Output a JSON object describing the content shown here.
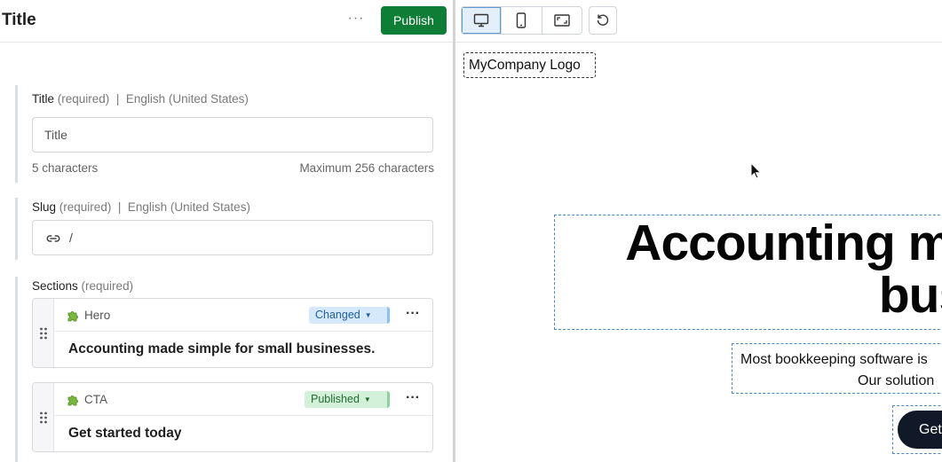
{
  "editor": {
    "title": "Title",
    "more_label": "···",
    "publish_label": "Publish",
    "fields": {
      "title": {
        "label": "Title",
        "required": "(required)",
        "separator": "|",
        "locale": "English (United States)",
        "value": "Title",
        "char_count": "5 characters",
        "max_chars": "Maximum 256 characters"
      },
      "slug": {
        "label": "Slug",
        "required": "(required)",
        "separator": "|",
        "locale": "English (United States)",
        "icon": "link-icon",
        "value": "/"
      },
      "sections": {
        "label": "Sections",
        "required": "(required)",
        "items": [
          {
            "type": "Hero",
            "icon": "puzzle-icon",
            "status": "Changed",
            "status_color": "#1f5f9e",
            "text": "Accounting made simple for small businesses."
          },
          {
            "type": "CTA",
            "icon": "puzzle-icon",
            "status": "Published",
            "status_color": "#216b34",
            "text": "Get started today"
          }
        ]
      }
    }
  },
  "preview": {
    "toolbar": {
      "devices": [
        {
          "icon": "desktop-icon",
          "active": true
        },
        {
          "icon": "mobile-icon",
          "active": false
        },
        {
          "icon": "resize-icon",
          "active": false
        }
      ],
      "refresh_icon": "refresh-icon"
    },
    "logo": "MyCompany Logo",
    "hero": {
      "heading_line1": "Accounting ma",
      "heading_line2": "busi",
      "sub_line1": "Most bookkeeping software is",
      "sub_line2": "Our solution",
      "cta": "Get"
    }
  },
  "colors": {
    "publish": "#0e7e36",
    "changed_badge": "#d5e9fb",
    "published_badge": "#d3f1d8",
    "cta_button": "#111827",
    "selection_outline": "#4f86c6"
  }
}
